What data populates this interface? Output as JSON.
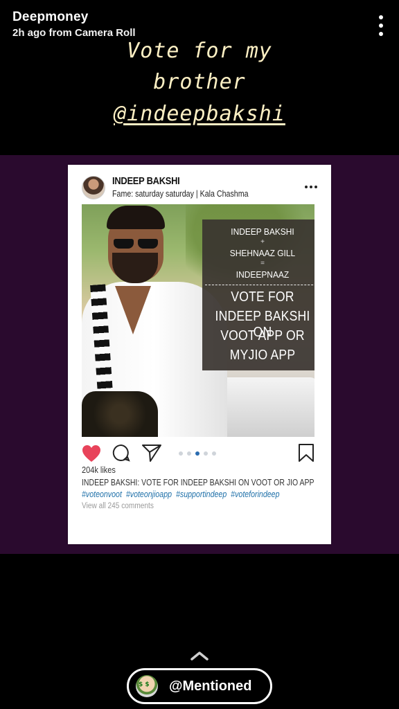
{
  "header": {
    "username": "Deepmoney",
    "subtitle": "2h ago from Camera Roll",
    "more_icon": "more-vertical-icon"
  },
  "caption": {
    "line1": "Vote for my",
    "line2": "brother",
    "line3": "@indeepbakshi"
  },
  "post": {
    "name": "INDEEP BAKSHI",
    "fame": "Fame: saturday saturday | Kala Chashma",
    "overlay": {
      "line1": "INDEEP BAKSHI",
      "plus": "+",
      "line2": "SHEHNAAZ GILL",
      "equals": "=",
      "line3": "INDEEPNAAZ",
      "vote1": "VOTE FOR",
      "vote2": "INDEEP BAKSHI ON",
      "vote3": "VOOT APP OR",
      "vote4": "MYJIO APP"
    },
    "likes": "204k likes",
    "caption": "INDEEP BAKSHI: VOTE FOR INDEEP BAKSHI ON VOOT OR JIO APP",
    "hashtags": [
      "#voteonvoot",
      "#voteonjioapp",
      "#supportindeep",
      "#voteforindeep"
    ],
    "view_comments": "View all 245 comments",
    "carousel": {
      "count": 5,
      "active_index": 2
    },
    "colors": {
      "heart": "#e8435a",
      "hashtag": "#1d6fa8",
      "active_dot": "#2b6cb0"
    }
  },
  "footer": {
    "mention_label": "@Mentioned",
    "chevron_icon": "chevron-up-icon"
  },
  "colors": {
    "background": "#000000",
    "media_background": "#2a0a2e",
    "caption_text": "#fdf0c4"
  }
}
